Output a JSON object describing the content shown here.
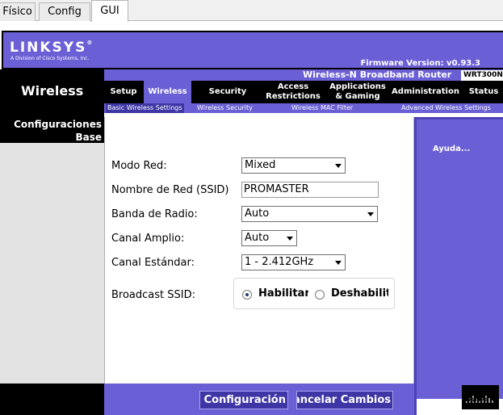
{
  "app_tabs": [
    {
      "label": "Físico"
    },
    {
      "label": "Config"
    },
    {
      "label": "GUI"
    }
  ],
  "header": {
    "logo": "LINKSYS",
    "logo_reg": "®",
    "logo_sub": "A Division of Cisco Systems, Inc.",
    "firmware": "Firmware Version: v0.93.3"
  },
  "product": {
    "name": "Wireless-N Broadband Router",
    "model": "WRT300N"
  },
  "section": "Wireless",
  "nav": {
    "setup": "Setup",
    "wireless": "Wireless",
    "security": "Security",
    "access_1": "Access",
    "access_2": "Restrictions",
    "apps_1": "Applications",
    "apps_2": "& Gaming",
    "admin": "Administration",
    "status": "Status"
  },
  "subnav": {
    "basic": "Basic Wireless Settings",
    "security": "Wireless Security",
    "mac": "Wireless MAC Filter",
    "advanced": "Advanced Wireless Settings"
  },
  "left": {
    "title_1": "Configuraciones",
    "title_2": "Base"
  },
  "form": {
    "modo_red_label": "Modo Red:",
    "modo_red_value": "Mixed",
    "ssid_label": "Nombre de Red (SSID)",
    "ssid_value": "PROMASTER",
    "banda_label": "Banda de Radio:",
    "banda_value": "Auto",
    "canal_amplio_label": "Canal Amplio:",
    "canal_amplio_value": "Auto",
    "canal_estandar_label": "Canal Estándar:",
    "canal_estandar_value": "1 - 2.412GHz",
    "broadcast_label": "Broadcast SSID:",
    "enable_label": "Habilitar",
    "disable_label": "Deshabilitar",
    "broadcast_selected": "Habilitar"
  },
  "help": {
    "link": "Ayuda..."
  },
  "cisco": {
    "text": "CISCO SYSTEMS"
  },
  "footer": {
    "save": "Guardar Configuración",
    "cancel": "Cancelar Cambios"
  }
}
